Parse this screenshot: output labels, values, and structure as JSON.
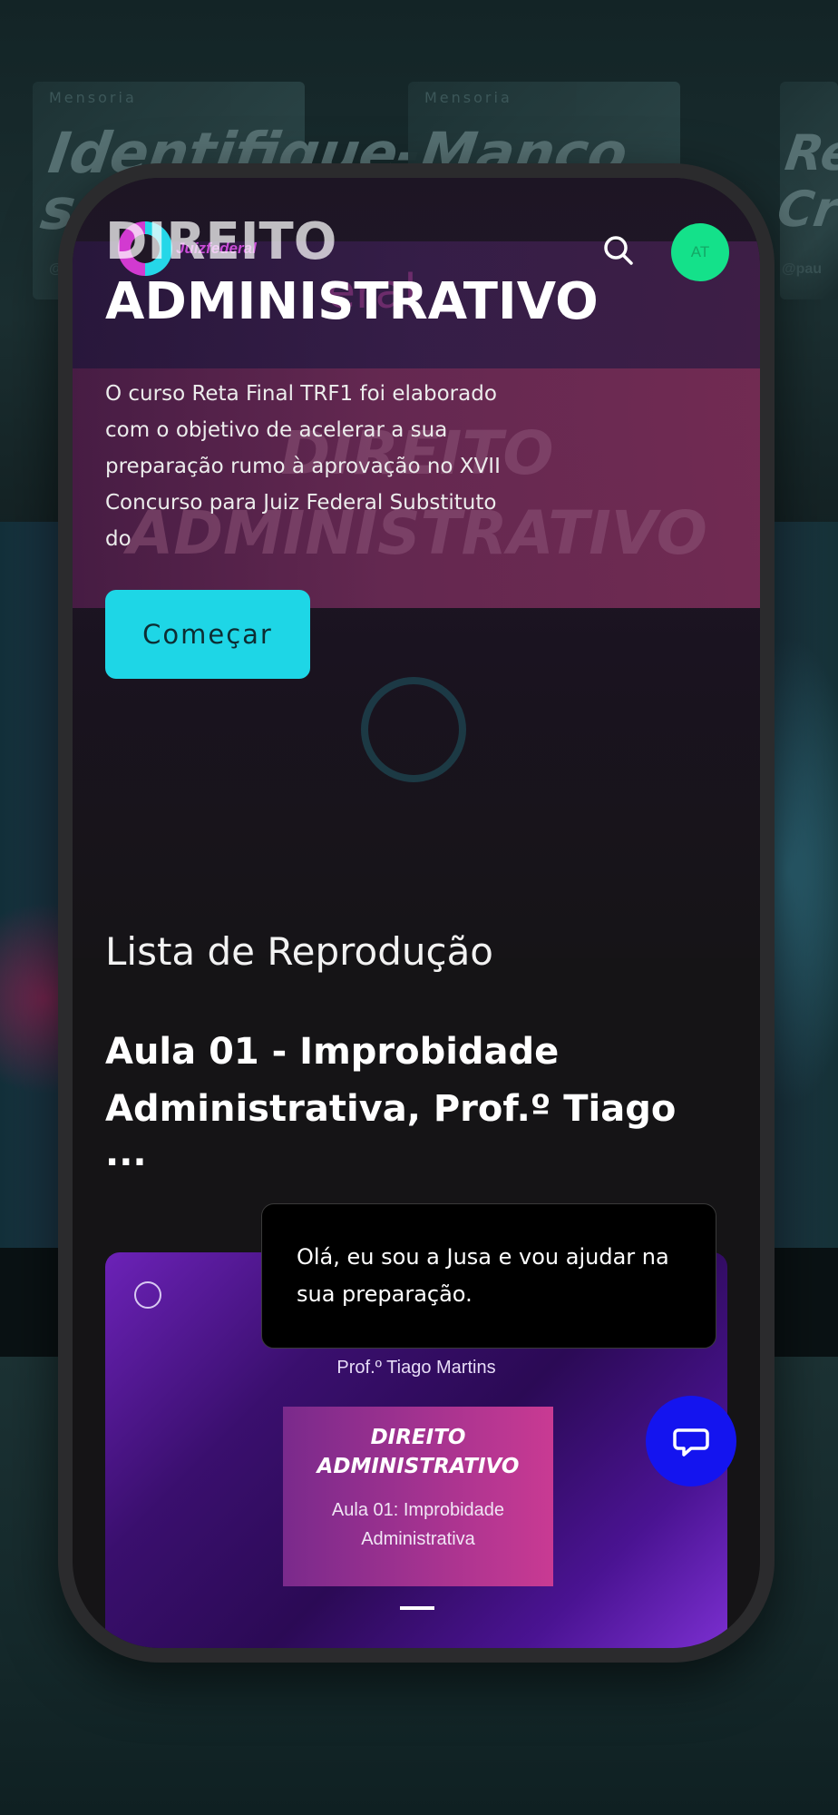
{
  "app": {
    "brand_name": "Juizfederal",
    "user_initials": "AT"
  },
  "background": {
    "tiles": [
      {
        "small": "Mensoria",
        "big": "Identifique-se",
        "tag": "@p"
      },
      {
        "small": "Mensoria",
        "big": "Manco",
        "tag": ""
      },
      {
        "small": "",
        "big": "Re Cr",
        "tag": "@pau"
      }
    ]
  },
  "hero": {
    "title_line1": "DIREITO",
    "title_line2": "ADMINISTRATIVO",
    "description": "O curso Reta Final TRF1 foi elaborado com o objetivo de acelerar a sua preparação rumo à aprovação no XVII Concurso para Juiz Federal Substituto do",
    "description_clamped": "O curso Reta Final TRF1 foi elaborado com o objetivo de acelerar a sua preparação rumo à aprovação no XVII Concurso...\npara Juiz Federal Substituto do",
    "start_button": "Começar",
    "ghost_text": "DIREITO ADMINISTRATIVO",
    "ghost_sub": "eral"
  },
  "playlist": {
    "section_title": "Lista de Reprodução",
    "lesson_title": "Aula 01 - Improbidade Administrativa, Prof.º Tiago",
    "lesson_ellipsis": "...",
    "thumbnail": {
      "teacher": "Prof.º Tiago Martins",
      "card_title": "DIREITO ADMINISTRATIVO",
      "card_sub": "Aula 01: Improbidade Administrativa"
    }
  },
  "chat": {
    "message": "Olá, eu sou a Jusa e vou ajudar na sua preparação."
  },
  "colors": {
    "accent": "#1ed6e6",
    "avatar": "#14e18a",
    "chat_button": "#1414ef"
  }
}
